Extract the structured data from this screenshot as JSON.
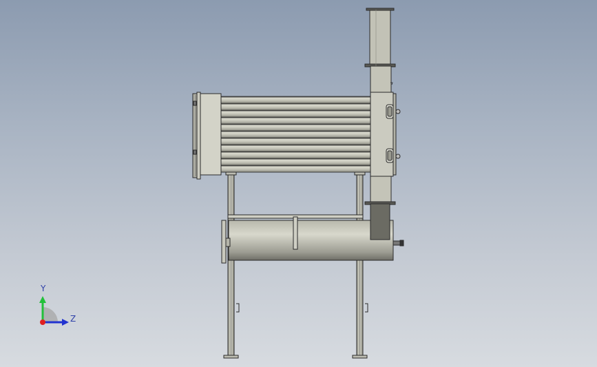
{
  "viewport": {
    "background_top": "#8c9bb0",
    "background_bottom": "#d7dbe0"
  },
  "model": {
    "part_color": "#c9c9bd",
    "edge_color": "#2a2a2a",
    "shadow_color": "#6f6f66"
  },
  "triad": {
    "y_label": "Y",
    "z_label": "Z",
    "y_color": "#22c03a",
    "z_color": "#2233d0",
    "x_color": "#e02020"
  }
}
